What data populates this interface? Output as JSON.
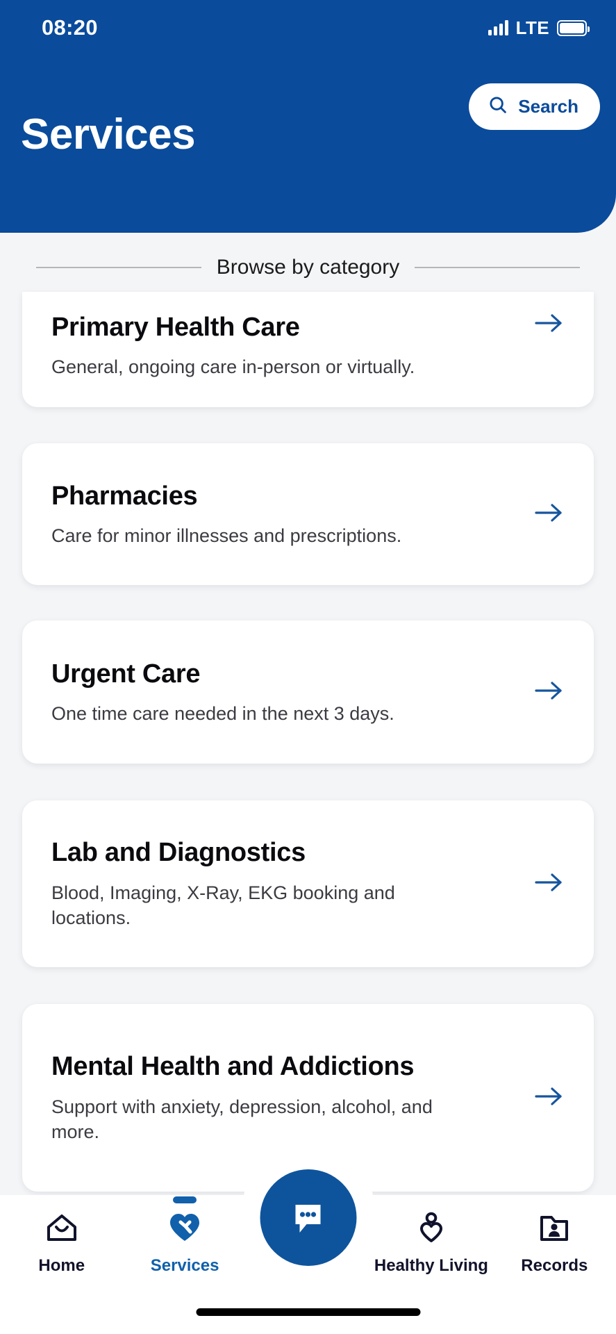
{
  "status_bar": {
    "time": "08:20",
    "network": "LTE",
    "signal_icon": "signal-bars-icon",
    "battery_icon": "battery-full-icon"
  },
  "header": {
    "title": "Services",
    "background_color": "#0a4b9b",
    "search": {
      "label": "Search",
      "icon": "search-icon",
      "text_color": "#0a4b9b"
    }
  },
  "section": {
    "browse_label": "Browse by category"
  },
  "categories": [
    {
      "title": "Primary Health Care",
      "description": "General, ongoing care in-person or virtually.",
      "arrow_icon": "arrow-right-icon"
    },
    {
      "title": "Pharmacies",
      "description": "Care for minor illnesses and prescriptions.",
      "arrow_icon": "arrow-right-icon"
    },
    {
      "title": "Urgent Care",
      "description": "One time care needed in the next 3 days.",
      "arrow_icon": "arrow-right-icon"
    },
    {
      "title": "Lab and Diagnostics",
      "description": "Blood, Imaging, X-Ray, EKG booking and locations.",
      "arrow_icon": "arrow-right-icon"
    },
    {
      "title": "Mental Health and Addictions",
      "description": "Support with anxiety, depression, alcohol, and more.",
      "arrow_icon": "arrow-right-icon"
    }
  ],
  "bottom_nav": {
    "accent_color": "#1160ab",
    "items": [
      {
        "label": "Home",
        "icon": "home-icon",
        "active": false
      },
      {
        "label": "Services",
        "icon": "heart-services-icon",
        "active": true
      },
      {
        "label": "Healthy Living",
        "icon": "person-heart-icon",
        "active": false
      },
      {
        "label": "Records",
        "icon": "folder-person-icon",
        "active": false
      }
    ],
    "fab": {
      "icon": "chat-bubble-icon",
      "background_color": "#0e549d"
    }
  }
}
